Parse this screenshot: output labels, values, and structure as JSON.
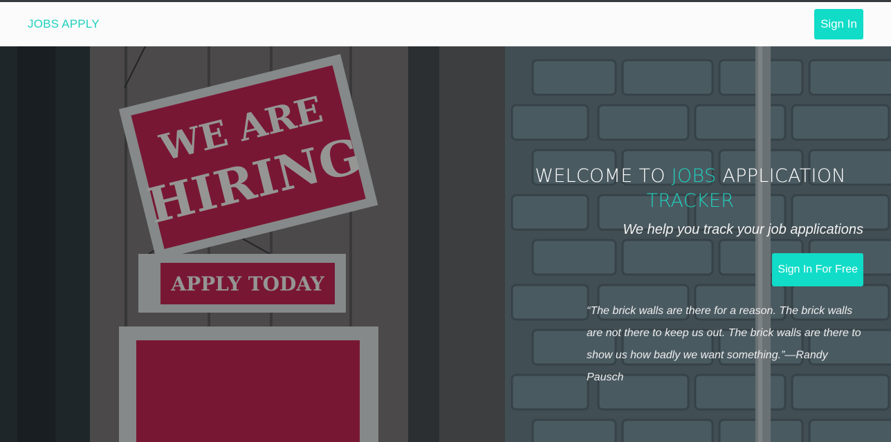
{
  "navbar": {
    "brand": "JOBS APPLY",
    "sign_in_label": "Sign In"
  },
  "hero": {
    "headline_part1": "WELCOME TO ",
    "headline_accent1": "JOBS",
    "headline_part2": " APPLICATION ",
    "headline_accent2": "TRACKER",
    "tagline": "We help you track your job applications",
    "cta_label": "Sign In For Free",
    "quote": "“The brick walls are there for a reason. The brick walls are not there to keep us out. The brick walls are there to show us how badly we want something.”—Randy Pausch",
    "sign_top_line1": "WE ARE",
    "sign_top_line2": "HIRING",
    "sign_middle": "APPLY TODAY"
  },
  "colors": {
    "accent": "#1fd1be",
    "button": "#10dcc8",
    "sign_red": "#b0173f"
  }
}
